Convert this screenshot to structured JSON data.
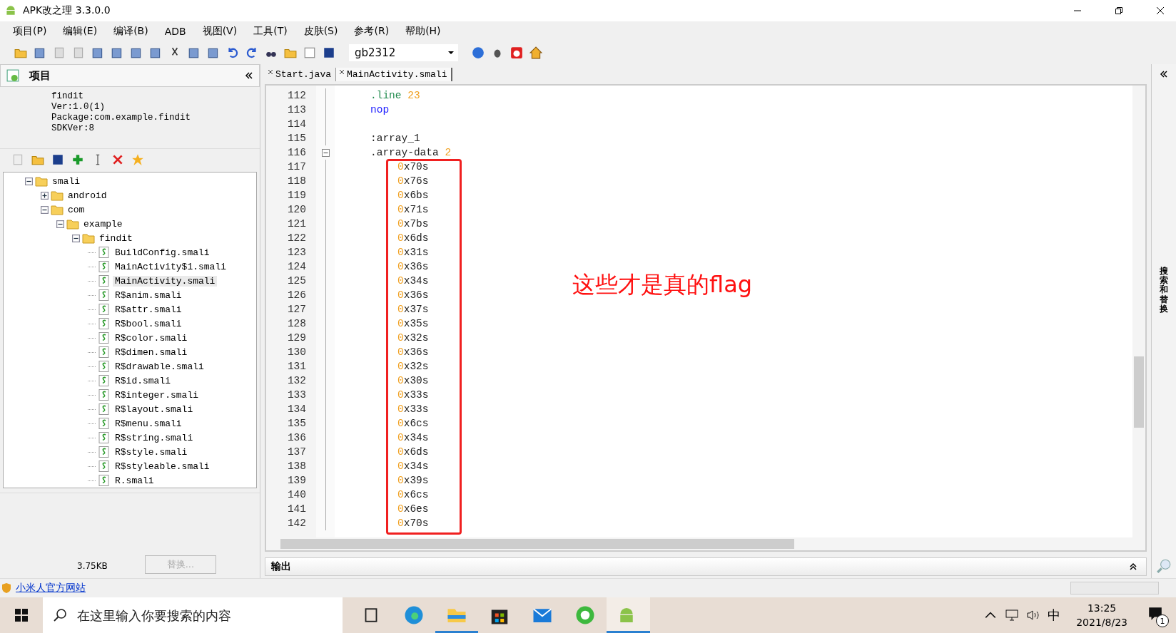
{
  "window": {
    "title": "APK改之理 3.3.0.0"
  },
  "menu": [
    "项目(P)",
    "编辑(E)",
    "编译(B)",
    "ADB",
    "视图(V)",
    "工具(T)",
    "皮肤(S)",
    "参考(R)",
    "帮助(H)"
  ],
  "toolbar": {
    "encoding": "gb2312"
  },
  "project_panel": {
    "title": "项目",
    "info": [
      "findit",
      "Ver:1.0(1)",
      "Package:com.example.findit",
      "SDKVer:8"
    ],
    "tree": [
      {
        "label": "smali",
        "kind": "folder",
        "expanded": true,
        "selected": false,
        "children": [
          {
            "label": "android",
            "kind": "folder",
            "expanded": false,
            "selected": false
          },
          {
            "label": "com",
            "kind": "folder",
            "expanded": true,
            "selected": false,
            "children": [
              {
                "label": "example",
                "kind": "folder",
                "expanded": true,
                "selected": false,
                "children": [
                  {
                    "label": "findit",
                    "kind": "folder",
                    "expanded": true,
                    "selected": false,
                    "children": [
                      {
                        "label": "BuildConfig.smali",
                        "kind": "file",
                        "selected": false
                      },
                      {
                        "label": "MainActivity$1.smali",
                        "kind": "file",
                        "selected": false
                      },
                      {
                        "label": "MainActivity.smali",
                        "kind": "file",
                        "selected": true
                      },
                      {
                        "label": "R$anim.smali",
                        "kind": "file",
                        "selected": false
                      },
                      {
                        "label": "R$attr.smali",
                        "kind": "file",
                        "selected": false
                      },
                      {
                        "label": "R$bool.smali",
                        "kind": "file",
                        "selected": false
                      },
                      {
                        "label": "R$color.smali",
                        "kind": "file",
                        "selected": false
                      },
                      {
                        "label": "R$dimen.smali",
                        "kind": "file",
                        "selected": false
                      },
                      {
                        "label": "R$drawable.smali",
                        "kind": "file",
                        "selected": false
                      },
                      {
                        "label": "R$id.smali",
                        "kind": "file",
                        "selected": false
                      },
                      {
                        "label": "R$integer.smali",
                        "kind": "file",
                        "selected": false
                      },
                      {
                        "label": "R$layout.smali",
                        "kind": "file",
                        "selected": false
                      },
                      {
                        "label": "R$menu.smali",
                        "kind": "file",
                        "selected": false
                      },
                      {
                        "label": "R$string.smali",
                        "kind": "file",
                        "selected": false
                      },
                      {
                        "label": "R$style.smali",
                        "kind": "file",
                        "selected": false
                      },
                      {
                        "label": "R$styleable.smali",
                        "kind": "file",
                        "selected": false
                      },
                      {
                        "label": "R.smali",
                        "kind": "file",
                        "selected": false
                      }
                    ]
                  }
                ]
              }
            ]
          }
        ]
      }
    ],
    "size": "3.75KB",
    "replace_button": {
      "label": "替换...",
      "disabled": true
    }
  },
  "tabs": [
    {
      "label": "Start.java",
      "selected": false
    },
    {
      "label": "MainActivity.smali",
      "selected": true
    }
  ],
  "code": [
    {
      "num": "112",
      "kind": "stmt",
      "tokens": [
        {
          "text": ".line ",
          "kind": "directive"
        },
        {
          "text": "23",
          "kind": "number"
        }
      ]
    },
    {
      "num": "113",
      "kind": "stmt",
      "tokens": [
        {
          "text": "nop",
          "kind": "keyword"
        }
      ]
    },
    {
      "num": "114",
      "kind": "blank"
    },
    {
      "num": "115",
      "kind": "stmt",
      "tokens": [
        {
          "text": ":array_1",
          "kind": "plain"
        }
      ]
    },
    {
      "num": "116",
      "kind": "stmt",
      "folded": false,
      "tokens": [
        {
          "text": ".array-data ",
          "kind": "plain"
        },
        {
          "text": "2",
          "kind": "number"
        }
      ]
    },
    {
      "num": "117",
      "kind": "entry",
      "tokens": [
        {
          "text": "0",
          "kind": "number"
        },
        {
          "text": "x70s",
          "kind": "plain"
        }
      ]
    },
    {
      "num": "118",
      "kind": "entry",
      "tokens": [
        {
          "text": "0",
          "kind": "number"
        },
        {
          "text": "x76s",
          "kind": "plain"
        }
      ]
    },
    {
      "num": "119",
      "kind": "entry",
      "tokens": [
        {
          "text": "0",
          "kind": "number"
        },
        {
          "text": "x6bs",
          "kind": "plain"
        }
      ]
    },
    {
      "num": "120",
      "kind": "entry",
      "tokens": [
        {
          "text": "0",
          "kind": "number"
        },
        {
          "text": "x71s",
          "kind": "plain"
        }
      ]
    },
    {
      "num": "121",
      "kind": "entry",
      "tokens": [
        {
          "text": "0",
          "kind": "number"
        },
        {
          "text": "x7bs",
          "kind": "plain"
        }
      ]
    },
    {
      "num": "122",
      "kind": "entry",
      "tokens": [
        {
          "text": "0",
          "kind": "number"
        },
        {
          "text": "x6ds",
          "kind": "plain"
        }
      ]
    },
    {
      "num": "123",
      "kind": "entry",
      "tokens": [
        {
          "text": "0",
          "kind": "number"
        },
        {
          "text": "x31s",
          "kind": "plain"
        }
      ]
    },
    {
      "num": "124",
      "kind": "entry",
      "tokens": [
        {
          "text": "0",
          "kind": "number"
        },
        {
          "text": "x36s",
          "kind": "plain"
        }
      ]
    },
    {
      "num": "125",
      "kind": "entry",
      "tokens": [
        {
          "text": "0",
          "kind": "number"
        },
        {
          "text": "x34s",
          "kind": "plain"
        }
      ]
    },
    {
      "num": "126",
      "kind": "entry",
      "tokens": [
        {
          "text": "0",
          "kind": "number"
        },
        {
          "text": "x36s",
          "kind": "plain"
        }
      ]
    },
    {
      "num": "127",
      "kind": "entry",
      "tokens": [
        {
          "text": "0",
          "kind": "number"
        },
        {
          "text": "x37s",
          "kind": "plain"
        }
      ]
    },
    {
      "num": "128",
      "kind": "entry",
      "tokens": [
        {
          "text": "0",
          "kind": "number"
        },
        {
          "text": "x35s",
          "kind": "plain"
        }
      ]
    },
    {
      "num": "129",
      "kind": "entry",
      "tokens": [
        {
          "text": "0",
          "kind": "number"
        },
        {
          "text": "x32s",
          "kind": "plain"
        }
      ]
    },
    {
      "num": "130",
      "kind": "entry",
      "tokens": [
        {
          "text": "0",
          "kind": "number"
        },
        {
          "text": "x36s",
          "kind": "plain"
        }
      ]
    },
    {
      "num": "131",
      "kind": "entry",
      "tokens": [
        {
          "text": "0",
          "kind": "number"
        },
        {
          "text": "x32s",
          "kind": "plain"
        }
      ]
    },
    {
      "num": "132",
      "kind": "entry",
      "tokens": [
        {
          "text": "0",
          "kind": "number"
        },
        {
          "text": "x30s",
          "kind": "plain"
        }
      ]
    },
    {
      "num": "133",
      "kind": "entry",
      "tokens": [
        {
          "text": "0",
          "kind": "number"
        },
        {
          "text": "x33s",
          "kind": "plain"
        }
      ]
    },
    {
      "num": "134",
      "kind": "entry",
      "tokens": [
        {
          "text": "0",
          "kind": "number"
        },
        {
          "text": "x33s",
          "kind": "plain"
        }
      ]
    },
    {
      "num": "135",
      "kind": "entry",
      "tokens": [
        {
          "text": "0",
          "kind": "number"
        },
        {
          "text": "x6cs",
          "kind": "plain"
        }
      ]
    },
    {
      "num": "136",
      "kind": "entry",
      "tokens": [
        {
          "text": "0",
          "kind": "number"
        },
        {
          "text": "x34s",
          "kind": "plain"
        }
      ]
    },
    {
      "num": "137",
      "kind": "entry",
      "tokens": [
        {
          "text": "0",
          "kind": "number"
        },
        {
          "text": "x6ds",
          "kind": "plain"
        }
      ]
    },
    {
      "num": "138",
      "kind": "entry",
      "tokens": [
        {
          "text": "0",
          "kind": "number"
        },
        {
          "text": "x34s",
          "kind": "plain"
        }
      ]
    },
    {
      "num": "139",
      "kind": "entry",
      "tokens": [
        {
          "text": "0",
          "kind": "number"
        },
        {
          "text": "x39s",
          "kind": "plain"
        }
      ]
    },
    {
      "num": "140",
      "kind": "entry",
      "tokens": [
        {
          "text": "0",
          "kind": "number"
        },
        {
          "text": "x6cs",
          "kind": "plain"
        }
      ]
    },
    {
      "num": "141",
      "kind": "entry",
      "tokens": [
        {
          "text": "0",
          "kind": "number"
        },
        {
          "text": "x6es",
          "kind": "plain"
        }
      ]
    },
    {
      "num": "142",
      "kind": "entry",
      "tokens": [
        {
          "text": "0",
          "kind": "number"
        },
        {
          "text": "x70s",
          "kind": "plain"
        }
      ]
    }
  ],
  "annotation": {
    "text": "这些才是真的flag"
  },
  "output_panel": {
    "title": "输出"
  },
  "side_panel": {
    "title": "搜索和替换"
  },
  "status_link": "小米人官方网站",
  "taskbar": {
    "search_placeholder": "在这里输入你要搜索的内容",
    "ime": "中",
    "time": "13:25",
    "date": "2021/8/23",
    "notifications": "1"
  }
}
